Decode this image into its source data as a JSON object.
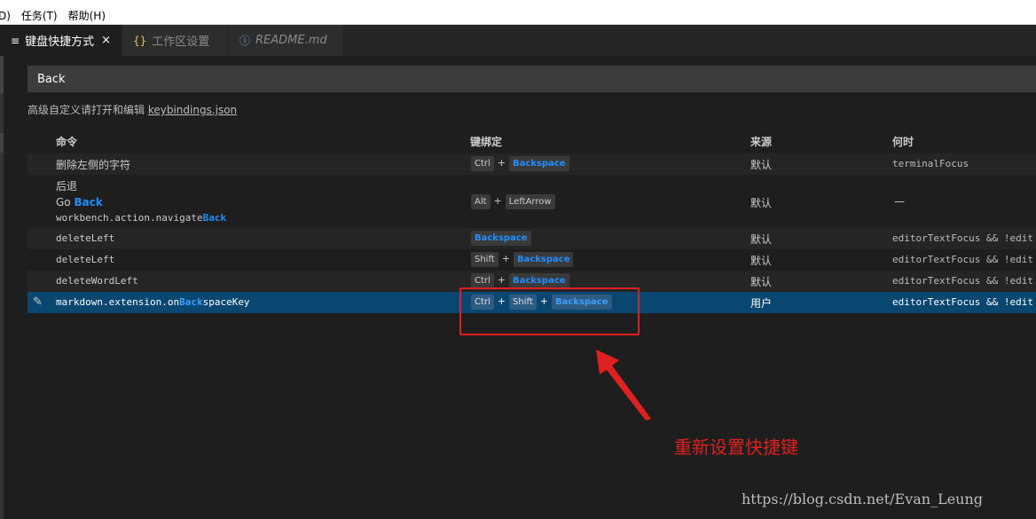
{
  "menubar": {
    "items": [
      "D)",
      "任务(T)",
      "帮助(H)"
    ]
  },
  "tabs": [
    {
      "icon": "≡",
      "label": "键盘快捷方式",
      "close": "×",
      "active": true
    },
    {
      "icon": "{}",
      "label": "工作区设置",
      "active": false
    },
    {
      "icon": "ⓘ",
      "label": "README.md",
      "active": false
    }
  ],
  "search": {
    "value": "Back"
  },
  "hint": {
    "text": "高级自定义请打开和编辑 ",
    "link": "keybindings.json"
  },
  "columns": {
    "command": "命令",
    "keybinding": "键绑定",
    "source": "来源",
    "when": "何时"
  },
  "rows": [
    {
      "command": "删除左侧的字符",
      "keys": [
        "Ctrl",
        "Backspace"
      ],
      "source": "默认",
      "when": "terminalFocus"
    },
    {
      "command_title": "后退",
      "command_sub_prefix": "Go ",
      "command_sub_hl": "Back",
      "command_id_prefix": "workbench.action.navigate",
      "command_id_hl": "Back",
      "keys": [
        "Alt",
        "LeftArrow"
      ],
      "source": "默认",
      "when": "—"
    },
    {
      "command": "deleteLeft",
      "keys": [
        "Backspace"
      ],
      "source": "默认",
      "when": "editorTextFocus && !edit"
    },
    {
      "command": "deleteLeft",
      "keys": [
        "Shift",
        "Backspace"
      ],
      "source": "默认",
      "when": "editorTextFocus && !edit"
    },
    {
      "command": "deleteWordLeft",
      "keys": [
        "Ctrl",
        "Backspace"
      ],
      "source": "默认",
      "when": "editorTextFocus && !edit"
    },
    {
      "command_prefix": "markdown.extension.on",
      "command_hl": "Back",
      "command_suffix": "spaceKey",
      "keys": [
        "Ctrl",
        "Shift",
        "Backspace"
      ],
      "source": "用户",
      "when": "editorTextFocus && !edit",
      "selected": true
    }
  ],
  "plus_sign": "+",
  "annotation": {
    "text": "重新设置快捷键",
    "color": "#e02020"
  },
  "watermark": "https://blog.csdn.net/Evan_Leung",
  "colors": {
    "accent": "#1f8fff",
    "selection": "#094771",
    "background": "#1e1e1e"
  }
}
